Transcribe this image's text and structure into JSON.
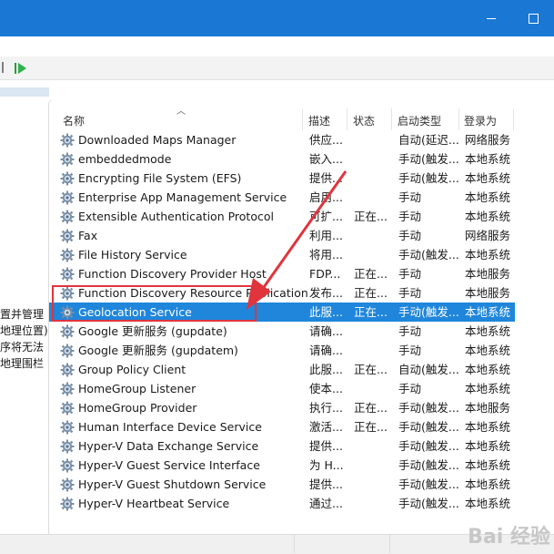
{
  "window": {
    "accent_color": "#1a78d4",
    "minimize_label": "",
    "maximize_label": ""
  },
  "toolbar": {
    "play_icon": "play-icon"
  },
  "left_panel": {
    "lines": [
      "置并管理",
      "地理位置)。",
      "序将无法",
      "地理围栏"
    ]
  },
  "columns": {
    "name": "名称",
    "desc": "描述",
    "status": "状态",
    "startup": "启动类型",
    "logon": "登录为"
  },
  "services": [
    {
      "name": "Downloaded Maps Manager",
      "desc": "供应...",
      "status": "",
      "startup": "自动(延迟...",
      "logon": "网络服务"
    },
    {
      "name": "embeddedmode",
      "desc": "嵌入...",
      "status": "",
      "startup": "手动(触发...",
      "logon": "本地系统"
    },
    {
      "name": "Encrypting File System (EFS)",
      "desc": "提供...",
      "status": "",
      "startup": "手动(触发...",
      "logon": "本地系统"
    },
    {
      "name": "Enterprise App Management Service",
      "desc": "启用...",
      "status": "",
      "startup": "手动",
      "logon": "本地系统"
    },
    {
      "name": "Extensible Authentication Protocol",
      "desc": "可扩...",
      "status": "正在...",
      "startup": "手动",
      "logon": "本地系统"
    },
    {
      "name": "Fax",
      "desc": "利用...",
      "status": "",
      "startup": "手动",
      "logon": "网络服务"
    },
    {
      "name": "File History Service",
      "desc": "将用...",
      "status": "",
      "startup": "手动(触发...",
      "logon": "本地系统"
    },
    {
      "name": "Function Discovery Provider Host",
      "desc": "FDP...",
      "status": "正在...",
      "startup": "手动",
      "logon": "本地服务"
    },
    {
      "name": "Function Discovery Resource Publication",
      "desc": "发布...",
      "status": "正在...",
      "startup": "手动",
      "logon": "本地服务"
    },
    {
      "name": "Geolocation Service",
      "desc": "此服...",
      "status": "正在...",
      "startup": "手动(触发...",
      "logon": "本地系统",
      "selected": true
    },
    {
      "name": "Google 更新服务 (gupdate)",
      "desc": "请确...",
      "status": "",
      "startup": "手动",
      "logon": "本地系统"
    },
    {
      "name": "Google 更新服务 (gupdatem)",
      "desc": "请确...",
      "status": "",
      "startup": "手动",
      "logon": "本地系统"
    },
    {
      "name": "Group Policy Client",
      "desc": "此服...",
      "status": "正在...",
      "startup": "自动(触发...",
      "logon": "本地系统"
    },
    {
      "name": "HomeGroup Listener",
      "desc": "使本...",
      "status": "",
      "startup": "手动",
      "logon": "本地系统"
    },
    {
      "name": "HomeGroup Provider",
      "desc": "执行...",
      "status": "正在...",
      "startup": "手动(触发...",
      "logon": "本地服务"
    },
    {
      "name": "Human Interface Device Service",
      "desc": "激活...",
      "status": "正在...",
      "startup": "手动(触发...",
      "logon": "本地系统"
    },
    {
      "name": "Hyper-V Data Exchange Service",
      "desc": "提供...",
      "status": "",
      "startup": "手动(触发...",
      "logon": "本地系统"
    },
    {
      "name": "Hyper-V Guest Service Interface",
      "desc": "为 H...",
      "status": "",
      "startup": "手动(触发...",
      "logon": "本地系统"
    },
    {
      "name": "Hyper-V Guest Shutdown Service",
      "desc": "提供...",
      "status": "",
      "startup": "手动(触发...",
      "logon": "本地系统"
    },
    {
      "name": "Hyper-V Heartbeat Service",
      "desc": "通过...",
      "status": "",
      "startup": "手动(触发...",
      "logon": "本地系统"
    }
  ],
  "watermark": "Bai 经验"
}
